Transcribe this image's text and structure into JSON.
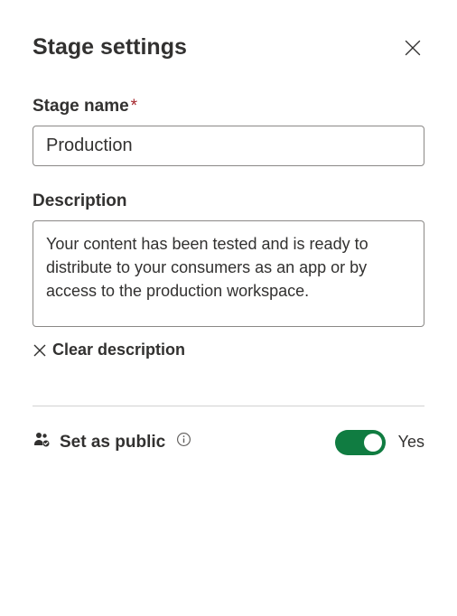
{
  "header": {
    "title": "Stage settings"
  },
  "stageName": {
    "label": "Stage name",
    "required_marker": "*",
    "value": "Production"
  },
  "description": {
    "label": "Description",
    "value": "Your content has been tested and is ready to distribute to your consumers as an app or by access to the production workspace.",
    "clear_label": "Clear description"
  },
  "public": {
    "label": "Set as public",
    "toggle_state": "on",
    "toggle_text": "Yes"
  },
  "colors": {
    "toggle_on": "#107c41"
  }
}
